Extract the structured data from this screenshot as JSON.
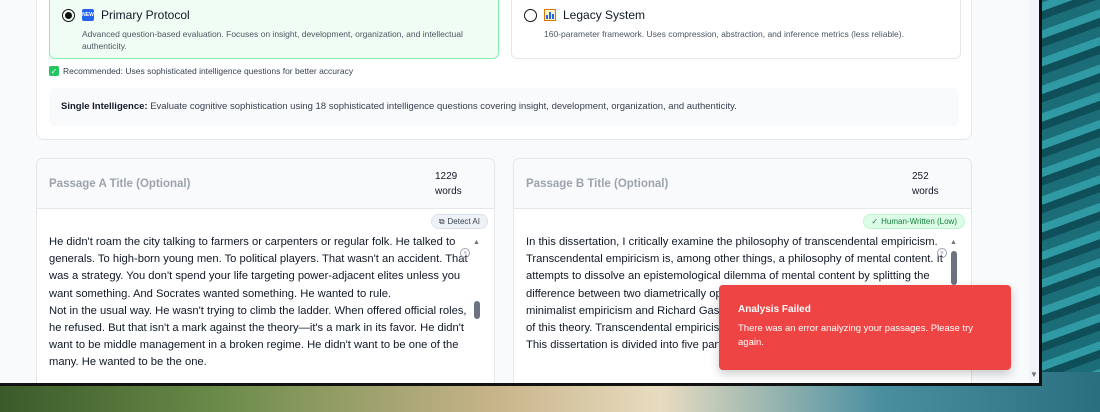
{
  "protocol": {
    "primary": {
      "label": "Primary Protocol",
      "icon": "new-icon",
      "icon_text": "NEW",
      "description": "Advanced question-based evaluation. Focuses on insight, development, organization, and intellectual authenticity.",
      "selected": true
    },
    "legacy": {
      "label": "Legacy System",
      "icon": "bar-chart-icon",
      "description": "160-parameter framework. Uses compression, abstraction, and inference metrics (less reliable).",
      "selected": false
    },
    "recommendation": "Recommended: Uses sophisticated intelligence questions for better accuracy",
    "info_label": "Single Intelligence:",
    "info_text": "Evaluate cognitive sophistication using 18 sophisticated intelligence questions covering insight, development, organization, and authenticity."
  },
  "passage_a": {
    "title_placeholder": "Passage A Title (Optional)",
    "word_count": "1229",
    "word_label": "words",
    "badge": "Detect AI",
    "text": "He didn't roam the city talking to farmers or carpenters or regular folk. He talked to generals. To high-born young men. To political players. That wasn't an accident. That was a strategy. You don't spend your life targeting power-adjacent elites unless you want something. And Socrates wanted something. He wanted to rule.\nNot in the usual way. He wasn't trying to climb the ladder. When offered official roles, he refused. But that isn't a mark against the theory—it's a mark in its favor. He didn't want to be middle management in a broken regime. He didn't want to be one of the many. He wanted to be the one."
  },
  "passage_b": {
    "title_placeholder": "Passage B Title (Optional)",
    "word_count": "252",
    "word_label": "words",
    "badge": "Human-Written (Low)",
    "text": "In this dissertation, I critically examine the philosophy of transcendental empiricism. Transcendental empiricism is, among other things, a philosophy of mental content. It attempts to dissolve an epistemological dilemma of mental content by splitting the difference between two diametrically opposed accounts of content. John McDowell's minimalist empiricism and Richard Gaskin's minimalist empiricism are two versions of this theory. Transcendental empiricism itself originates in the work of McDowell. This dissertation is divided into five parts. First, in the Introduction, I state the"
  },
  "toast": {
    "title": "Analysis Failed",
    "message": "There was an error analyzing your passages. Please try again."
  },
  "colors": {
    "toast_bg": "#ef4444",
    "primary_option_bg": "#f0fdf4",
    "primary_option_border": "#86efac",
    "success_green": "#22c55e"
  }
}
